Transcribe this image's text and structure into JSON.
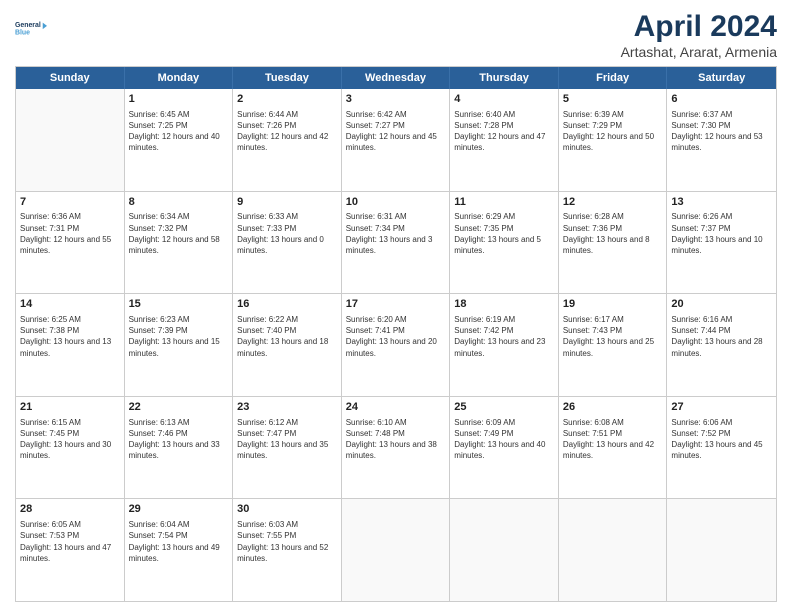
{
  "header": {
    "logo_line1": "General",
    "logo_line2": "Blue",
    "title": "April 2024",
    "subtitle": "Artashat, Ararat, Armenia"
  },
  "weekdays": [
    "Sunday",
    "Monday",
    "Tuesday",
    "Wednesday",
    "Thursday",
    "Friday",
    "Saturday"
  ],
  "weeks": [
    [
      {
        "day": "",
        "empty": true
      },
      {
        "day": "1",
        "sunrise": "6:45 AM",
        "sunset": "7:25 PM",
        "daylight": "12 hours and 40 minutes."
      },
      {
        "day": "2",
        "sunrise": "6:44 AM",
        "sunset": "7:26 PM",
        "daylight": "12 hours and 42 minutes."
      },
      {
        "day": "3",
        "sunrise": "6:42 AM",
        "sunset": "7:27 PM",
        "daylight": "12 hours and 45 minutes."
      },
      {
        "day": "4",
        "sunrise": "6:40 AM",
        "sunset": "7:28 PM",
        "daylight": "12 hours and 47 minutes."
      },
      {
        "day": "5",
        "sunrise": "6:39 AM",
        "sunset": "7:29 PM",
        "daylight": "12 hours and 50 minutes."
      },
      {
        "day": "6",
        "sunrise": "6:37 AM",
        "sunset": "7:30 PM",
        "daylight": "12 hours and 53 minutes."
      }
    ],
    [
      {
        "day": "7",
        "sunrise": "6:36 AM",
        "sunset": "7:31 PM",
        "daylight": "12 hours and 55 minutes."
      },
      {
        "day": "8",
        "sunrise": "6:34 AM",
        "sunset": "7:32 PM",
        "daylight": "12 hours and 58 minutes."
      },
      {
        "day": "9",
        "sunrise": "6:33 AM",
        "sunset": "7:33 PM",
        "daylight": "13 hours and 0 minutes."
      },
      {
        "day": "10",
        "sunrise": "6:31 AM",
        "sunset": "7:34 PM",
        "daylight": "13 hours and 3 minutes."
      },
      {
        "day": "11",
        "sunrise": "6:29 AM",
        "sunset": "7:35 PM",
        "daylight": "13 hours and 5 minutes."
      },
      {
        "day": "12",
        "sunrise": "6:28 AM",
        "sunset": "7:36 PM",
        "daylight": "13 hours and 8 minutes."
      },
      {
        "day": "13",
        "sunrise": "6:26 AM",
        "sunset": "7:37 PM",
        "daylight": "13 hours and 10 minutes."
      }
    ],
    [
      {
        "day": "14",
        "sunrise": "6:25 AM",
        "sunset": "7:38 PM",
        "daylight": "13 hours and 13 minutes."
      },
      {
        "day": "15",
        "sunrise": "6:23 AM",
        "sunset": "7:39 PM",
        "daylight": "13 hours and 15 minutes."
      },
      {
        "day": "16",
        "sunrise": "6:22 AM",
        "sunset": "7:40 PM",
        "daylight": "13 hours and 18 minutes."
      },
      {
        "day": "17",
        "sunrise": "6:20 AM",
        "sunset": "7:41 PM",
        "daylight": "13 hours and 20 minutes."
      },
      {
        "day": "18",
        "sunrise": "6:19 AM",
        "sunset": "7:42 PM",
        "daylight": "13 hours and 23 minutes."
      },
      {
        "day": "19",
        "sunrise": "6:17 AM",
        "sunset": "7:43 PM",
        "daylight": "13 hours and 25 minutes."
      },
      {
        "day": "20",
        "sunrise": "6:16 AM",
        "sunset": "7:44 PM",
        "daylight": "13 hours and 28 minutes."
      }
    ],
    [
      {
        "day": "21",
        "sunrise": "6:15 AM",
        "sunset": "7:45 PM",
        "daylight": "13 hours and 30 minutes."
      },
      {
        "day": "22",
        "sunrise": "6:13 AM",
        "sunset": "7:46 PM",
        "daylight": "13 hours and 33 minutes."
      },
      {
        "day": "23",
        "sunrise": "6:12 AM",
        "sunset": "7:47 PM",
        "daylight": "13 hours and 35 minutes."
      },
      {
        "day": "24",
        "sunrise": "6:10 AM",
        "sunset": "7:48 PM",
        "daylight": "13 hours and 38 minutes."
      },
      {
        "day": "25",
        "sunrise": "6:09 AM",
        "sunset": "7:49 PM",
        "daylight": "13 hours and 40 minutes."
      },
      {
        "day": "26",
        "sunrise": "6:08 AM",
        "sunset": "7:51 PM",
        "daylight": "13 hours and 42 minutes."
      },
      {
        "day": "27",
        "sunrise": "6:06 AM",
        "sunset": "7:52 PM",
        "daylight": "13 hours and 45 minutes."
      }
    ],
    [
      {
        "day": "28",
        "sunrise": "6:05 AM",
        "sunset": "7:53 PM",
        "daylight": "13 hours and 47 minutes."
      },
      {
        "day": "29",
        "sunrise": "6:04 AM",
        "sunset": "7:54 PM",
        "daylight": "13 hours and 49 minutes."
      },
      {
        "day": "30",
        "sunrise": "6:03 AM",
        "sunset": "7:55 PM",
        "daylight": "13 hours and 52 minutes."
      },
      {
        "day": "",
        "empty": true
      },
      {
        "day": "",
        "empty": true
      },
      {
        "day": "",
        "empty": true
      },
      {
        "day": "",
        "empty": true
      }
    ]
  ]
}
